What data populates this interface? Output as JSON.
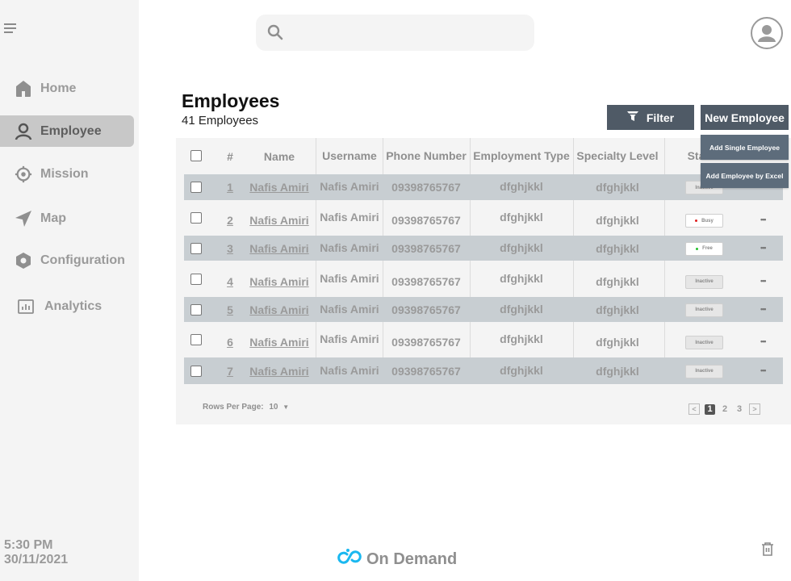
{
  "sidebar": {
    "menu_icon": "hamburger-icon",
    "items": [
      {
        "label": "Home",
        "icon": "home-icon",
        "active": false
      },
      {
        "label": "Employee",
        "icon": "person-icon",
        "active": true
      },
      {
        "label": "Mission",
        "icon": "target-icon",
        "active": false
      },
      {
        "label": "Map",
        "icon": "navigation-arrow-icon",
        "active": false
      },
      {
        "label": "Configuration",
        "icon": "hexagon-gear-icon",
        "active": false
      },
      {
        "label": "Analytics",
        "icon": "bar-chart-icon",
        "active": false
      }
    ],
    "time": "5:30 PM",
    "date": "30/11/2021"
  },
  "header": {
    "search_placeholder": "",
    "search_value": "",
    "avatar_icon": "user-avatar-icon"
  },
  "page": {
    "title": "Employees",
    "subtitle": "41 Employees",
    "filter_label": "Filter",
    "new_employee_label": "New Employee",
    "new_employee_menu": [
      "Add Single Employee",
      "Add Employee by Excel"
    ]
  },
  "table": {
    "columns": [
      "#",
      "Name",
      "Username",
      "Phone Number",
      "Employment Type",
      "Specialty Level",
      "Status"
    ],
    "rows": [
      {
        "num": "1",
        "name": "Nafis Amiri",
        "username": "Nafis Amiri",
        "phone": "09398765767",
        "employment_type": "dfghjkkl",
        "specialty_level": "dfghjkkl",
        "status": "Inactive",
        "status_color": ""
      },
      {
        "num": "2",
        "name": "Nafis Amiri",
        "username": "Nafis Amiri",
        "phone": "09398765767",
        "employment_type": "dfghjkkl",
        "specialty_level": "dfghjkkl",
        "status": "Busy",
        "status_color": "#e02020"
      },
      {
        "num": "3",
        "name": "Nafis Amiri",
        "username": "Nafis Amiri",
        "phone": "09398765767",
        "employment_type": "dfghjkkl",
        "specialty_level": "dfghjkkl",
        "status": "Free",
        "status_color": "#22c02a"
      },
      {
        "num": "4",
        "name": "Nafis Amiri",
        "username": "Nafis Amiri",
        "phone": "09398765767",
        "employment_type": "dfghjkkl",
        "specialty_level": "dfghjkkl",
        "status": "Inactive",
        "status_color": ""
      },
      {
        "num": "5",
        "name": "Nafis Amiri",
        "username": "Nafis Amiri",
        "phone": "09398765767",
        "employment_type": "dfghjkkl",
        "specialty_level": "dfghjkkl",
        "status": "Inactive",
        "status_color": ""
      },
      {
        "num": "6",
        "name": "Nafis Amiri",
        "username": "Nafis Amiri",
        "phone": "09398765767",
        "employment_type": "dfghjkkl",
        "specialty_level": "dfghjkkl",
        "status": "Inactive",
        "status_color": ""
      },
      {
        "num": "7",
        "name": "Nafis Amiri",
        "username": "Nafis Amiri",
        "phone": "09398765767",
        "employment_type": "dfghjkkl",
        "specialty_level": "dfghjkkl",
        "status": "Inactive",
        "status_color": ""
      }
    ],
    "more_label": "•••",
    "rows_per_page_label": "Rows Per Page:",
    "rows_per_page_value": "10",
    "pages": [
      "1",
      "2",
      "3"
    ],
    "current_page": "1"
  },
  "footer": {
    "brand": "On Demand",
    "brand_color": "#1ab8f0",
    "trash_icon": "trash-icon"
  },
  "colors": {
    "primary_button": "#4f5a66",
    "menu_button": "#5d6c7b",
    "row_shade": "#c8ced2",
    "sidebar_bg": "#f4f4f4"
  }
}
